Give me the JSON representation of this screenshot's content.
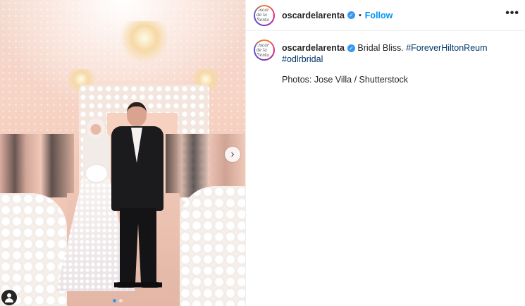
{
  "post": {
    "author": {
      "username": "oscardelarenta",
      "avatar_text": "Oscar de la Renta",
      "verified": true
    },
    "follow_label": "Follow",
    "separator": "•",
    "more_label": "•••",
    "caption": {
      "text": "Bridal Bliss.",
      "hashtags": [
        "#ForeverHiltonReum",
        "#odlrbridal"
      ],
      "credit": "Photos: Jose Villa / Shutterstock"
    },
    "carousel": {
      "next_icon": "›",
      "slide_count": 2,
      "active_index": 0
    },
    "colors": {
      "link_blue": "#0095f6",
      "hashtag_blue": "#00376b",
      "verified_blue": "#3897f0"
    }
  }
}
